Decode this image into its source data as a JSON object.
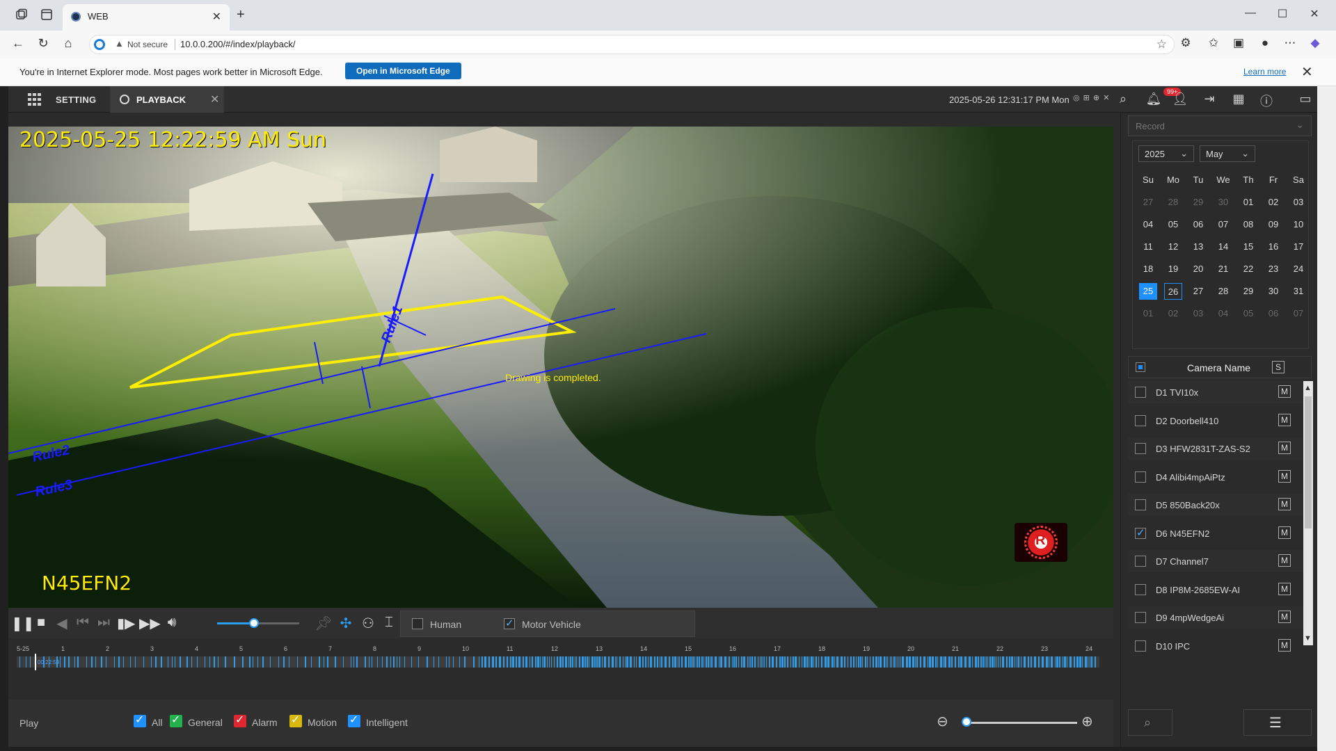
{
  "browser": {
    "tab_title": "WEB",
    "not_secure": "Not secure",
    "url": "10.0.0.200/#/index/playback/",
    "ie_message": "You're in Internet Explorer mode. Most pages work better in Microsoft Edge.",
    "open_edge": "Open in Microsoft Edge",
    "learn_more": "Learn more"
  },
  "app": {
    "setting_tab": "SETTING",
    "playback_tab": "PLAYBACK",
    "clock": "2025-05-26 12:31:17 PM Mon",
    "badge": "99+"
  },
  "video": {
    "timestamp": "2025-05-25 12:22:59 AM Sun",
    "camera_label": "N45EFN2",
    "drawing_msg": "Drawing is completed.",
    "rules": [
      "Rule1",
      "Rule2",
      "Rule3"
    ],
    "overlay_color": "#ffee00",
    "rule_color": "#1a1aff"
  },
  "controls": {
    "volume_level": 0.45,
    "filters": [
      {
        "label": "Human",
        "checked": false
      },
      {
        "label": "Motor Vehicle",
        "checked": true
      }
    ]
  },
  "timeline": {
    "start_label": "5-25",
    "hours": [
      "1",
      "2",
      "3",
      "4",
      "5",
      "6",
      "7",
      "8",
      "9",
      "10",
      "11",
      "12",
      "13",
      "14",
      "15",
      "16",
      "17",
      "18",
      "19",
      "20",
      "21",
      "22",
      "23",
      "24"
    ],
    "cursor_label": "00:22:59",
    "record_color": "#2f9cea"
  },
  "status": {
    "play_label": "Play",
    "types": [
      {
        "label": "All",
        "color": "#1e90ff"
      },
      {
        "label": "General",
        "color": "#22b14c"
      },
      {
        "label": "Alarm",
        "color": "#e0262f"
      },
      {
        "label": "Motion",
        "color": "#d8b80e"
      },
      {
        "label": "Intelligent",
        "color": "#1e90ff"
      }
    ]
  },
  "panel": {
    "record_select": "Record",
    "year": "2025",
    "month": "May",
    "weekdays": [
      "Su",
      "Mo",
      "Tu",
      "We",
      "Th",
      "Fr",
      "Sa"
    ],
    "days": [
      [
        "27",
        "28",
        "29",
        "30",
        "01",
        "02",
        "03"
      ],
      [
        "04",
        "05",
        "06",
        "07",
        "08",
        "09",
        "10"
      ],
      [
        "11",
        "12",
        "13",
        "14",
        "15",
        "16",
        "17"
      ],
      [
        "18",
        "19",
        "20",
        "21",
        "22",
        "23",
        "24"
      ],
      [
        "25",
        "26",
        "27",
        "28",
        "29",
        "30",
        "31"
      ],
      [
        "01",
        "02",
        "03",
        "04",
        "05",
        "06",
        "07"
      ]
    ],
    "selected_day": "25",
    "today": "26",
    "camera_header": "Camera Name",
    "s_label": "S",
    "m_label": "M",
    "cameras": [
      {
        "name": "D1 TVI10x",
        "checked": false
      },
      {
        "name": "D2 Doorbell410",
        "checked": false
      },
      {
        "name": "D3 HFW2831T-ZAS-S2",
        "checked": false
      },
      {
        "name": "D4 Alibi4mpAiPtz",
        "checked": false
      },
      {
        "name": "D5 850Back20x",
        "checked": false
      },
      {
        "name": "D6 N45EFN2",
        "checked": true
      },
      {
        "name": "D7 Channel7",
        "checked": false
      },
      {
        "name": "D8 IP8M-2685EW-AI",
        "checked": false
      },
      {
        "name": "D9 4mpWedgeAi",
        "checked": false
      },
      {
        "name": "D10 IPC",
        "checked": false
      }
    ]
  }
}
